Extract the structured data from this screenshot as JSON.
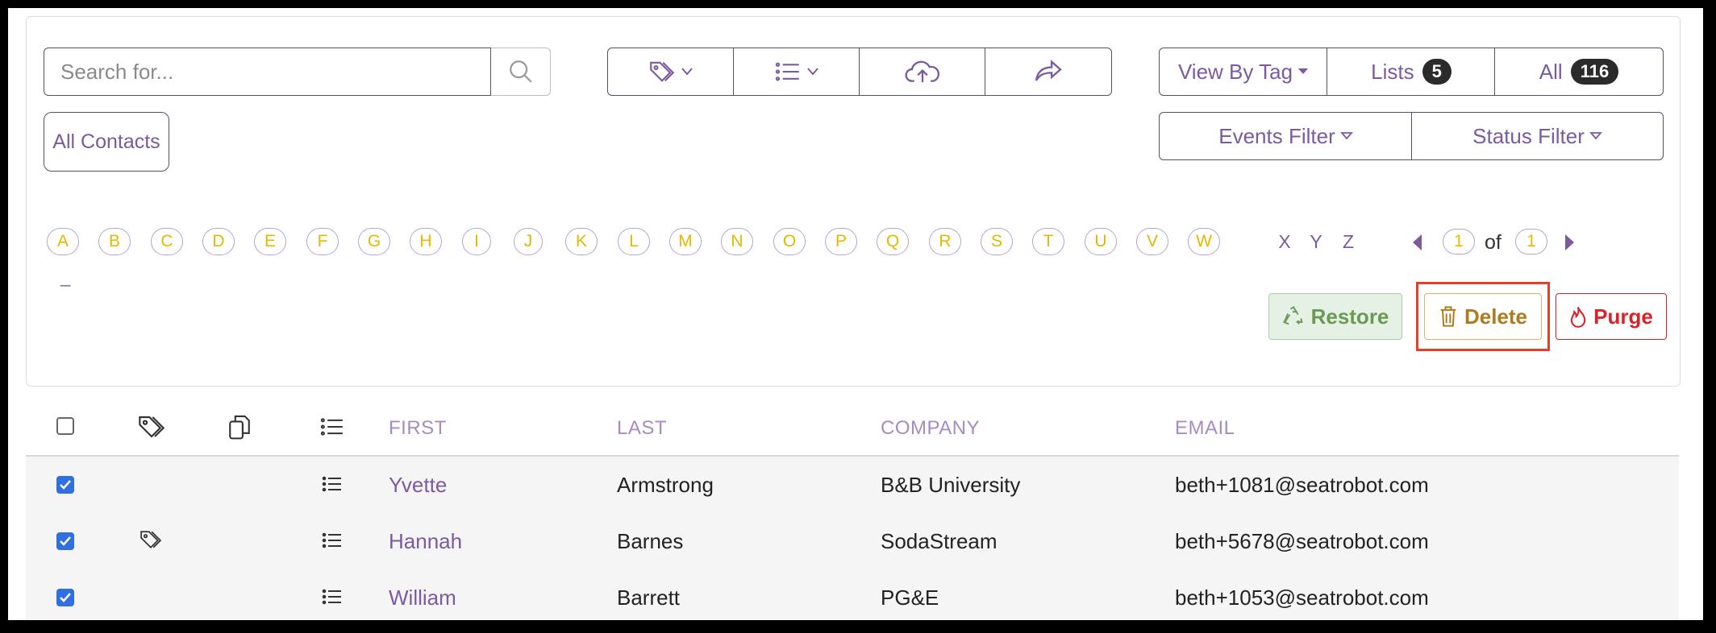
{
  "search": {
    "placeholder": "Search for..."
  },
  "toolbar": {
    "view_by_tag": "View By Tag",
    "lists_label": "Lists",
    "lists_count": "5",
    "all_label": "All",
    "all_count": "116",
    "events_filter": "Events Filter",
    "status_filter": "Status Filter",
    "all_contacts": "All Contacts"
  },
  "alphabet": {
    "letters": [
      "A",
      "B",
      "C",
      "D",
      "E",
      "F",
      "G",
      "H",
      "I",
      "J",
      "K",
      "L",
      "M",
      "N",
      "O",
      "P",
      "Q",
      "R",
      "S",
      "T",
      "U",
      "V",
      "W"
    ],
    "plain_letters": [
      "X",
      "Y",
      "Z"
    ],
    "extra": "_"
  },
  "pagination": {
    "current": "1",
    "of_label": "of",
    "total": "1"
  },
  "actions": {
    "restore": "Restore",
    "delete": "Delete",
    "purge": "Purge"
  },
  "table": {
    "headers": [
      "FIRST",
      "LAST",
      "COMPANY",
      "EMAIL"
    ],
    "rows": [
      {
        "first": "Yvette",
        "last": "Armstrong",
        "company": "B&B University",
        "email": "beth+1081@seatrobot.com",
        "tagged": false
      },
      {
        "first": "Hannah",
        "last": "Barnes",
        "company": "SodaStream",
        "email": "beth+5678@seatrobot.com",
        "tagged": true
      },
      {
        "first": "William",
        "last": "Barrett",
        "company": "PG&E",
        "email": "beth+1053@seatrobot.com",
        "tagged": false
      }
    ]
  },
  "colors": {
    "accent_purple": "#7b5aa0",
    "letter_yellow": "#e6b800",
    "restore_green": "#6a9a55",
    "delete_gold": "#b07a1e",
    "purge_red": "#d9232b",
    "highlight_red": "#e2402a"
  },
  "icons": [
    "search-icon",
    "tag-icon",
    "list-icon",
    "cloud-upload-icon",
    "share-icon",
    "copy-icon",
    "recycle-icon",
    "trash-icon",
    "flame-icon"
  ]
}
